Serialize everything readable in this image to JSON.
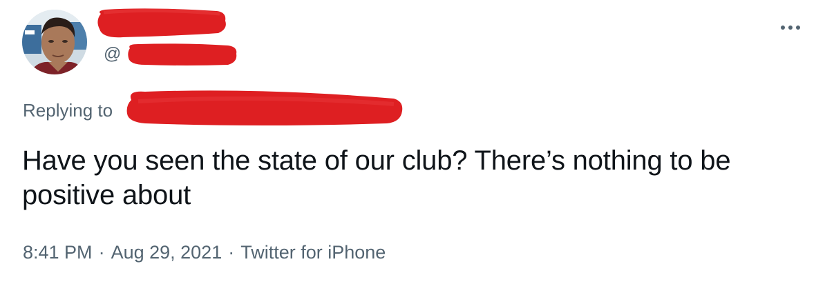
{
  "tweet": {
    "handle_prefix": "@",
    "replying_label": "Replying to",
    "text": "Have you seen the state of our club? There’s nothing to be positive about",
    "time": "8:41 PM",
    "date": "Aug 29, 2021",
    "source": "Twitter for iPhone",
    "separator": "·"
  },
  "icons": {
    "more": "more-horizontal-icon"
  },
  "colors": {
    "redaction": "#de1f22",
    "secondary_text": "#536471",
    "primary_text": "#0f1419"
  }
}
